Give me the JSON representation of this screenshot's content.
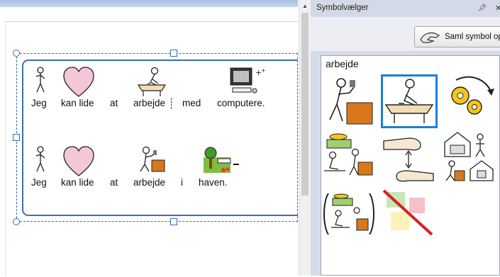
{
  "document": {
    "rows": [
      {
        "words": [
          {
            "text": "Jeg",
            "symbol": "person-icon"
          },
          {
            "text": "kan lide",
            "symbol": "heart-icon"
          },
          {
            "text": "at",
            "symbol": "blank"
          },
          {
            "text": "arbejde",
            "symbol": "writing-at-desk-icon"
          },
          {
            "text": "med",
            "symbol": "blank"
          },
          {
            "text": "computere.",
            "symbol": "computer-icon"
          }
        ]
      },
      {
        "words": [
          {
            "text": "Jeg",
            "symbol": "person-icon"
          },
          {
            "text": "kan lide",
            "symbol": "heart-icon"
          },
          {
            "text": "at",
            "symbol": "blank"
          },
          {
            "text": "arbejde",
            "symbol": "worker-with-box-icon"
          },
          {
            "text": "i",
            "symbol": "blank"
          },
          {
            "text": "haven.",
            "symbol": "garden-icon"
          }
        ]
      }
    ]
  },
  "panel": {
    "title": "Symbolvælger",
    "pin_icon": "pin-icon",
    "close_icon": "close-icon",
    "collect_button": "Saml symbol op",
    "word": "arbejde",
    "symbols": [
      {
        "name": "worker-carrying-box",
        "selected": false
      },
      {
        "name": "writing-at-desk",
        "selected": true
      },
      {
        "name": "gears-process",
        "selected": false
      },
      {
        "name": "money-and-worker",
        "selected": false
      },
      {
        "name": "hands-exchange",
        "selected": false
      },
      {
        "name": "workplace-house",
        "selected": false
      },
      {
        "name": "money-worker-bracketed",
        "selected": false
      },
      {
        "name": "no-symbol",
        "selected": false
      }
    ]
  },
  "colors": {
    "accent": "#1b7fd6",
    "frame": "#3f6fae",
    "panel_bg": "#d6dbe9",
    "heart": "#f4c6d9",
    "box": "#d9781a"
  }
}
